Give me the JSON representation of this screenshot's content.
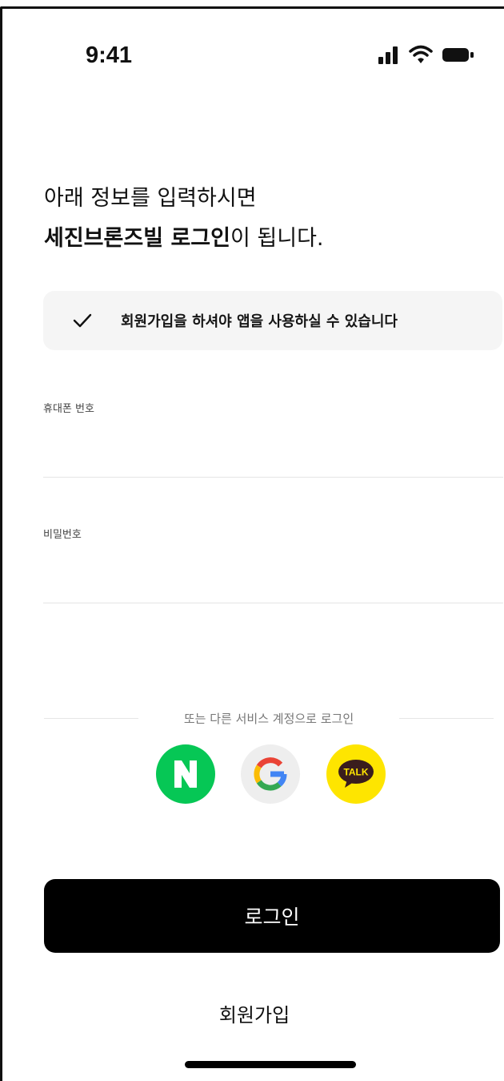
{
  "status_bar": {
    "time": "9:41"
  },
  "heading": {
    "line1": "아래 정보를 입력하시면",
    "line2_brand": "세진브론즈빌 로그인",
    "line2_rest": "이 됩니다."
  },
  "notice": {
    "text": "회원가입을 하셔야 앱을 사용하실 수 있습니다"
  },
  "form": {
    "phone": {
      "label": "휴대폰 번호",
      "value": "",
      "placeholder": ""
    },
    "password": {
      "label": "비밀번호",
      "value": "",
      "placeholder": ""
    }
  },
  "social": {
    "divider_text": "또는 다른 서비스 계정으로 로그인",
    "providers": [
      {
        "name": "naver",
        "icon": "naver-icon",
        "color": "#06c755"
      },
      {
        "name": "google",
        "icon": "google-icon",
        "color": "#eeeeee"
      },
      {
        "name": "kakao",
        "icon": "kakao-talk-icon",
        "color": "#fee500",
        "badge": "TALK"
      }
    ]
  },
  "actions": {
    "login_label": "로그인",
    "signup_label": "회원가입"
  },
  "colors": {
    "primary_button": "#000000",
    "notice_bg": "#f5f5f5"
  }
}
